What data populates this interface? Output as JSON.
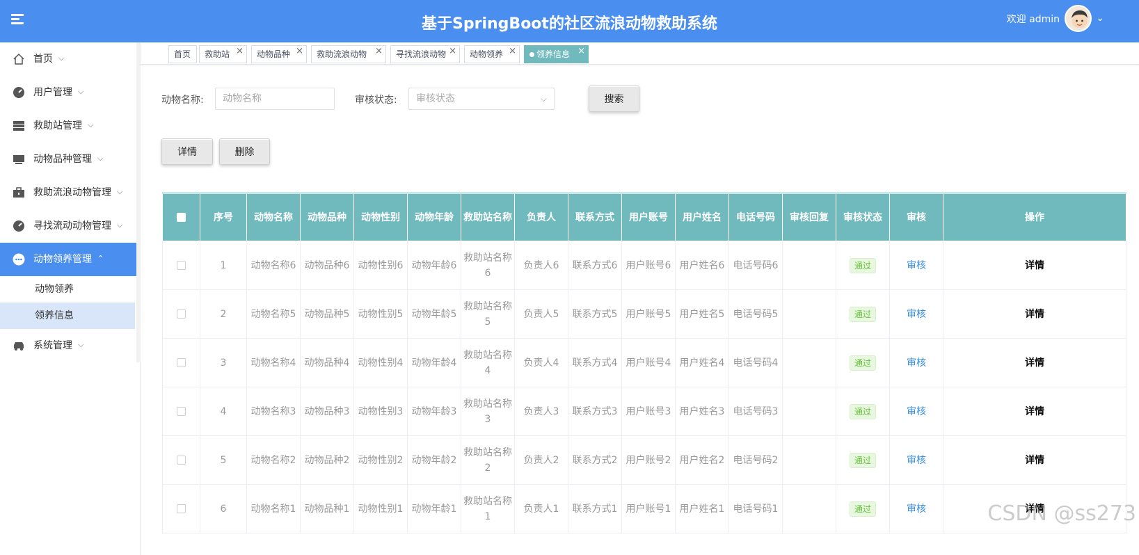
{
  "header": {
    "title": "基于SpringBoot的社区流浪动物救助系统",
    "welcome": "欢迎 admin"
  },
  "sidebar": {
    "items": [
      {
        "label": "首页",
        "icon": "home-icon"
      },
      {
        "label": "用户管理",
        "icon": "gauge-icon"
      },
      {
        "label": "救助站管理",
        "icon": "list-icon"
      },
      {
        "label": "动物品种管理",
        "icon": "monitor-icon"
      },
      {
        "label": "救助流浪动物管理",
        "icon": "briefcase-icon"
      },
      {
        "label": "寻找流动动物管理",
        "icon": "gauge-icon"
      },
      {
        "label": "动物领养管理",
        "icon": "dots-icon"
      },
      {
        "label": "系统管理",
        "icon": "car-icon"
      }
    ],
    "submenu": [
      "动物领养",
      "领养信息"
    ]
  },
  "tabs": [
    "首页",
    "救助站",
    "动物品种",
    "救助流浪动物",
    "寻找流浪动物",
    "动物领养",
    "领养信息"
  ],
  "search": {
    "name_label": "动物名称:",
    "name_placeholder": "动物名称",
    "status_label": "审核状态:",
    "status_placeholder": "审核状态",
    "search_button": "搜索"
  },
  "actions": {
    "detail": "详情",
    "delete": "删除"
  },
  "table": {
    "headers": [
      "序号",
      "动物名称",
      "动物品种",
      "动物性别",
      "动物年龄",
      "救助站名称",
      "负责人",
      "联系方式",
      "用户账号",
      "用户姓名",
      "电话号码",
      "审核回复",
      "审核状态",
      "审核",
      "操作"
    ],
    "rows": [
      {
        "no": "1",
        "name": "动物名称6",
        "breed": "动物品种6",
        "gender": "动物性别6",
        "age": "动物年龄6",
        "station": "救助站名称6",
        "owner": "负责人6",
        "contact": "联系方式6",
        "account": "用户账号6",
        "username": "用户姓名6",
        "phone": "电话号码6",
        "reply": "",
        "status": "通过",
        "review": "审核",
        "op": "详情"
      },
      {
        "no": "2",
        "name": "动物名称5",
        "breed": "动物品种5",
        "gender": "动物性别5",
        "age": "动物年龄5",
        "station": "救助站名称5",
        "owner": "负责人5",
        "contact": "联系方式5",
        "account": "用户账号5",
        "username": "用户姓名5",
        "phone": "电话号码5",
        "reply": "",
        "status": "通过",
        "review": "审核",
        "op": "详情"
      },
      {
        "no": "3",
        "name": "动物名称4",
        "breed": "动物品种4",
        "gender": "动物性别4",
        "age": "动物年龄4",
        "station": "救助站名称4",
        "owner": "负责人4",
        "contact": "联系方式4",
        "account": "用户账号4",
        "username": "用户姓名4",
        "phone": "电话号码4",
        "reply": "",
        "status": "通过",
        "review": "审核",
        "op": "详情"
      },
      {
        "no": "4",
        "name": "动物名称3",
        "breed": "动物品种3",
        "gender": "动物性别3",
        "age": "动物年龄3",
        "station": "救助站名称3",
        "owner": "负责人3",
        "contact": "联系方式3",
        "account": "用户账号3",
        "username": "用户姓名3",
        "phone": "电话号码3",
        "reply": "",
        "status": "通过",
        "review": "审核",
        "op": "详情"
      },
      {
        "no": "5",
        "name": "动物名称2",
        "breed": "动物品种2",
        "gender": "动物性别2",
        "age": "动物年龄2",
        "station": "救助站名称2",
        "owner": "负责人2",
        "contact": "联系方式2",
        "account": "用户账号2",
        "username": "用户姓名2",
        "phone": "电话号码2",
        "reply": "",
        "status": "通过",
        "review": "审核",
        "op": "详情"
      },
      {
        "no": "6",
        "name": "动物名称1",
        "breed": "动物品种1",
        "gender": "动物性别1",
        "age": "动物年龄1",
        "station": "救助站名称1",
        "owner": "负责人1",
        "contact": "联系方式1",
        "account": "用户账号1",
        "username": "用户姓名1",
        "phone": "电话号码1",
        "reply": "",
        "status": "通过",
        "review": "审核",
        "op": "详情"
      }
    ]
  },
  "watermark": "CSDN @ss273",
  "colors": {
    "header": "#4a8ef0",
    "table_header": "#70b9bd",
    "active_tab": "#70b9bd",
    "status_tag": "#67c23a",
    "link": "#3a8ee6"
  }
}
